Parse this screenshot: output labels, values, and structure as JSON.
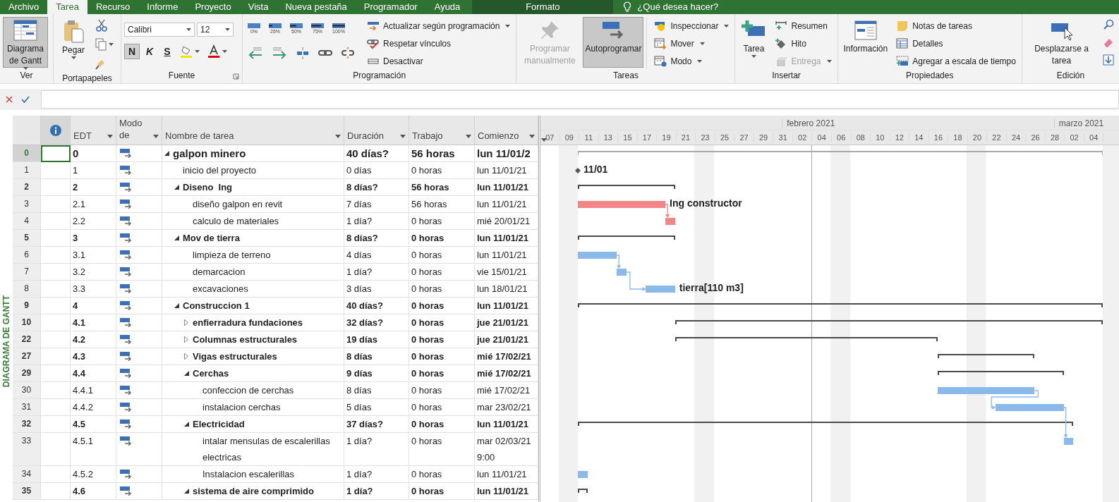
{
  "ribbon": {
    "tabs": [
      {
        "label": "Archivo",
        "selected": false
      },
      {
        "label": "Tarea",
        "selected": true
      },
      {
        "label": "Recurso",
        "selected": false
      },
      {
        "label": "Informe",
        "selected": false
      },
      {
        "label": "Proyecto",
        "selected": false
      },
      {
        "label": "Vista",
        "selected": false
      },
      {
        "label": "Nueva pestaña",
        "selected": false
      },
      {
        "label": "Programador",
        "selected": false
      },
      {
        "label": "Ayuda",
        "selected": false
      }
    ],
    "context_tab": "Formato",
    "tell_me": "¿Qué desea hacer?",
    "view": {
      "label": "Ver",
      "button": "Diagrama de Gantt",
      "selected": true
    },
    "clipboard": {
      "label": "Portapapeles",
      "paste": "Pegar"
    },
    "font": {
      "label": "Fuente",
      "font_name": "Calibri",
      "font_size": "12",
      "bold": "N",
      "italic": "K",
      "underline": "S",
      "bold_selected": true
    },
    "schedule": {
      "label": "Programación",
      "percents": [
        "0%",
        "25%",
        "50%",
        "75%",
        "100%"
      ],
      "commands": [
        "Actualizar según programación",
        "Respetar vínculos",
        "Desactivar"
      ]
    },
    "tasks": {
      "label": "Tareas",
      "manual": {
        "label": "Programar manualmente",
        "disabled": true
      },
      "auto": {
        "label": "Autoprogramar",
        "selected": true
      },
      "commands": [
        "Inspeccionar",
        "Mover",
        "Modo"
      ]
    },
    "insert": {
      "label": "Insertar",
      "task": "Tarea",
      "commands": [
        {
          "label": "Resumen",
          "disabled": false
        },
        {
          "label": "Hito",
          "disabled": false
        },
        {
          "label": "Entrega",
          "disabled": true
        }
      ]
    },
    "properties": {
      "label": "Propiedades",
      "info": "Información",
      "commands": [
        "Notas de tareas",
        "Detalles",
        "Agregar a escala de tiempo"
      ]
    },
    "editing": {
      "label": "Edición",
      "scroll": "Desplazarse a tarea"
    }
  },
  "view_label": "DIAGRAMA DE GANTT",
  "table": {
    "columns": [
      "EDT",
      "Modo de",
      "Nombre de tarea",
      "Duración",
      "Trabajo",
      "Comienzo"
    ],
    "rows": [
      {
        "row": "0",
        "edt": "0",
        "name": "galpon minero",
        "duration": "40 días?",
        "work": "56 horas",
        "start": "lun 11/01/2",
        "kind": "project",
        "selected": true,
        "expanded": true,
        "children": [
          {
            "row": "1",
            "edt": "1",
            "name": "inicio del proyecto",
            "duration": "0 días",
            "work": "0 horas",
            "start": "lun 11/01/21",
            "kind": "milestone",
            "selected": false,
            "bar": {
              "label": "11/01"
            }
          },
          {
            "row": "2",
            "edt": "2",
            "name": "Diseno  Ing",
            "duration": "8 días?",
            "work": "56 horas",
            "start": "lun 11/01/21",
            "kind": "summary",
            "selected": false,
            "expanded": true,
            "children": [
              {
                "row": "3",
                "edt": "2.1",
                "name": "diseño galpon en revit",
                "duration": "7 días",
                "work": "56 horas",
                "start": "lun 11/01/21",
                "kind": "task",
                "selected": false,
                "bar": {
                  "color": "#f28686",
                  "label": "Ing constructor",
                  "linked": true
                }
              },
              {
                "row": "4",
                "edt": "2.2",
                "name": "calculo de materiales",
                "duration": "1 día?",
                "work": "0 horas",
                "start": "mié 20/01/21",
                "kind": "task",
                "selected": false,
                "bar": {
                  "color": "#f28686"
                }
              }
            ]
          },
          {
            "row": "5",
            "edt": "3",
            "name": "Mov de tierra",
            "duration": "8 días?",
            "work": "0 horas",
            "start": "lun 11/01/21",
            "kind": "summary",
            "selected": false,
            "expanded": true,
            "children": [
              {
                "row": "6",
                "edt": "3.1",
                "name": "limpieza de terreno",
                "duration": "4 días",
                "work": "0 horas",
                "start": "lun 11/01/21",
                "kind": "task",
                "selected": false,
                "bar": {
                  "color": "#8ab9ea",
                  "linked": true
                }
              },
              {
                "row": "7",
                "edt": "3.2",
                "name": "demarcacion",
                "duration": "1 día?",
                "work": "0 horas",
                "start": "vie 15/01/21",
                "kind": "task",
                "selected": false,
                "bar": {
                  "color": "#8ab9ea",
                  "linked": true
                }
              },
              {
                "row": "8",
                "edt": "3.3",
                "name": "excavaciones",
                "duration": "3 días",
                "work": "0 horas",
                "start": "lun 18/01/21",
                "kind": "task",
                "selected": false,
                "bar": {
                  "color": "#8ab9ea",
                  "label": "tierra[110 m3]"
                }
              }
            ]
          },
          {
            "row": "9",
            "edt": "4",
            "name": "Construccion 1",
            "duration": "40 días?",
            "work": "0 horas",
            "start": "lun 11/01/21",
            "kind": "summary",
            "selected": false,
            "expanded": true,
            "children": [
              {
                "row": "10",
                "edt": "4.1",
                "name": "enfierradura fundaciones",
                "duration": "32 días?",
                "work": "0 horas",
                "start": "jue 21/01/21",
                "kind": "summary",
                "selected": false,
                "expanded": false
              },
              {
                "row": "22",
                "edt": "4.2",
                "name": "Columnas estructurales",
                "duration": "19 días",
                "work": "0 horas",
                "start": "jue 21/01/21",
                "kind": "summary",
                "selected": false,
                "expanded": false
              },
              {
                "row": "27",
                "edt": "4.3",
                "name": "Vigas estructurales",
                "duration": "8 días",
                "work": "0 horas",
                "start": "mié 17/02/21",
                "kind": "summary",
                "selected": false,
                "expanded": false
              },
              {
                "row": "29",
                "edt": "4.4",
                "name": "Cerchas",
                "duration": "9 días",
                "work": "0 horas",
                "start": "mié 17/02/21",
                "kind": "summary",
                "selected": false,
                "expanded": true,
                "children": [
                  {
                    "row": "30",
                    "edt": "4.4.1",
                    "name": "confeccion de cerchas",
                    "duration": "8 días",
                    "work": "0 horas",
                    "start": "mié 17/02/21",
                    "kind": "task",
                    "selected": false,
                    "bar": {
                      "color": "#8ab9ea",
                      "linked": true
                    }
                  },
                  {
                    "row": "31",
                    "edt": "4.4.2",
                    "name": "instalacion cerchas",
                    "duration": "5 días",
                    "work": "0 horas",
                    "start": "mar 23/02/21",
                    "kind": "task",
                    "selected": false,
                    "bar": {
                      "color": "#8ab9ea",
                      "linked": true
                    }
                  }
                ]
              },
              {
                "row": "32",
                "edt": "4.5",
                "name": "Electricidad",
                "duration": "37 días?",
                "work": "0 horas",
                "start": "lun 11/01/21",
                "kind": "summary",
                "selected": false,
                "expanded": true,
                "children": [
                  {
                    "row": "33",
                    "edt": "4.5.1",
                    "name": "intalar mensulas de escalerillas electricas",
                    "duration": "1 día?",
                    "work": "0 horas",
                    "start": "mar 02/03/21 9:00",
                    "kind": "task",
                    "selected": false,
                    "bar": {
                      "color": "#8ab9ea"
                    }
                  },
                  {
                    "row": "34",
                    "edt": "4.5.2",
                    "name": "Instalacion escalerillas",
                    "duration": "1 día?",
                    "work": "0 horas",
                    "start": "lun 11/01/21",
                    "kind": "task",
                    "selected": false,
                    "bar": {
                      "color": "#8ab9ea"
                    }
                  }
                ]
              },
              {
                "row": "35",
                "edt": "4.6",
                "name": "sistema de aire comprimido",
                "duration": "1 día?",
                "work": "0 horas",
                "start": "lun 11/01/21",
                "kind": "summary",
                "selected": false,
                "expanded": true
              }
            ]
          }
        ]
      }
    ]
  },
  "gantt": {
    "months": [
      {
        "label": "febrero 2021"
      },
      {
        "label": "marzo 2021"
      }
    ],
    "days": [
      "07",
      "09",
      "11",
      "13",
      "15",
      "17",
      "19",
      "21",
      "23",
      "25",
      "27",
      "29",
      "31",
      "02",
      "04",
      "06",
      "08",
      "10",
      "12",
      "14",
      "16",
      "18",
      "20",
      "22",
      "24",
      "26",
      "28",
      "02",
      "04"
    ]
  }
}
